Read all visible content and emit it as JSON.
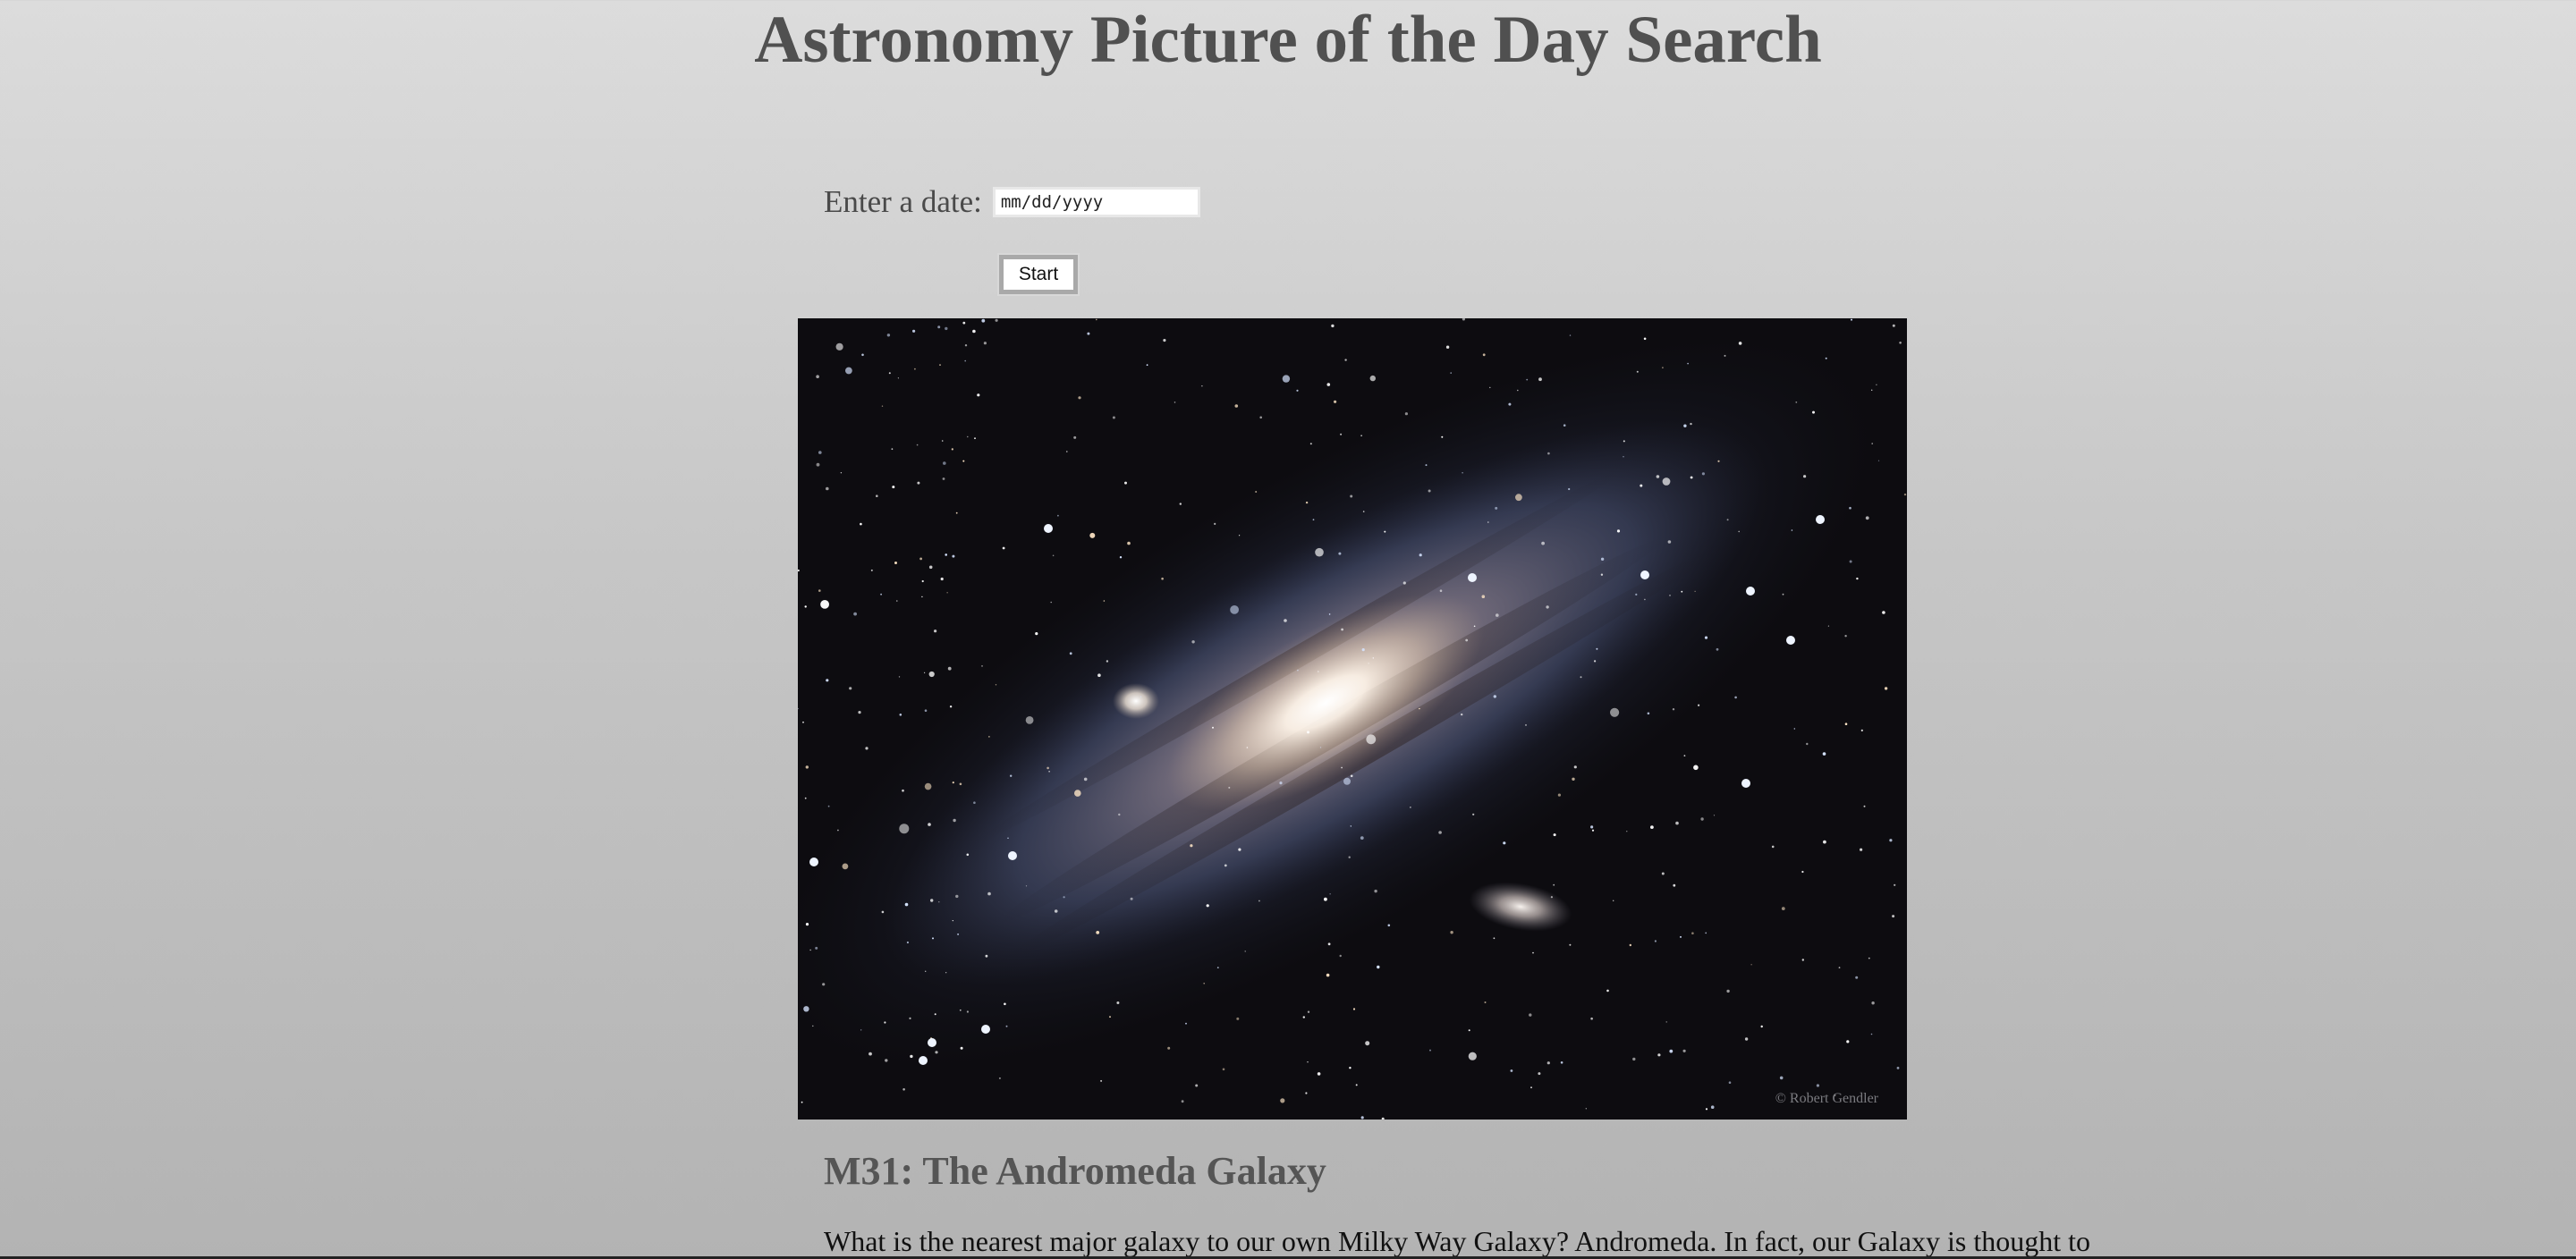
{
  "header": {
    "title": "Astronomy Picture of the Day Search"
  },
  "search": {
    "label": "Enter a date:",
    "placeholder": "mm/dd/yyyy",
    "start_label": "Start"
  },
  "apod": {
    "image_credit": "© Robert Gendler",
    "title": "M31: The Andromeda Galaxy",
    "explanation": "What is the nearest major galaxy to our own Milky Way Galaxy? Andromeda. In fact, our Galaxy is thought to"
  },
  "colors": {
    "title_text": "#505050",
    "background_top": "#dcdcdc",
    "background_bottom": "#b3b3b3",
    "image_background": "#0d0c10"
  }
}
